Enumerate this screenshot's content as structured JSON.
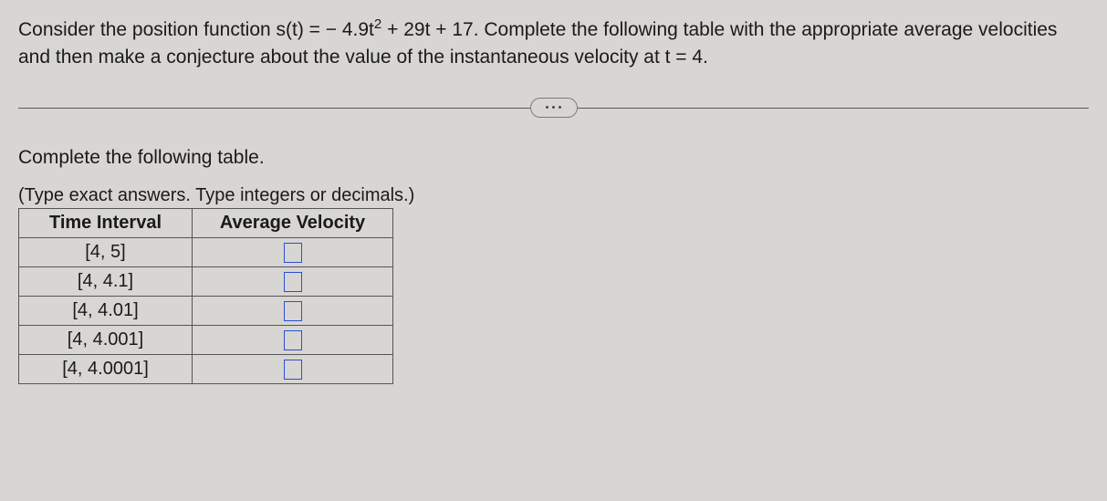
{
  "problem": {
    "line": "Consider the position function s(t) = − 4.9t² + 29t + 17. Complete the following table with the appropriate average velocities and then make a conjecture about the value of the instantaneous velocity at t = 4."
  },
  "instruction": "Complete the following table.",
  "hint": "(Type exact answers. Type integers or decimals.)",
  "table": {
    "headers": {
      "interval": "Time Interval",
      "velocity": "Average Velocity"
    },
    "rows": [
      {
        "interval": "[4, 5]",
        "velocity": ""
      },
      {
        "interval": "[4, 4.1]",
        "velocity": ""
      },
      {
        "interval": "[4, 4.01]",
        "velocity": ""
      },
      {
        "interval": "[4, 4.001]",
        "velocity": ""
      },
      {
        "interval": "[4, 4.0001]",
        "velocity": ""
      }
    ]
  }
}
